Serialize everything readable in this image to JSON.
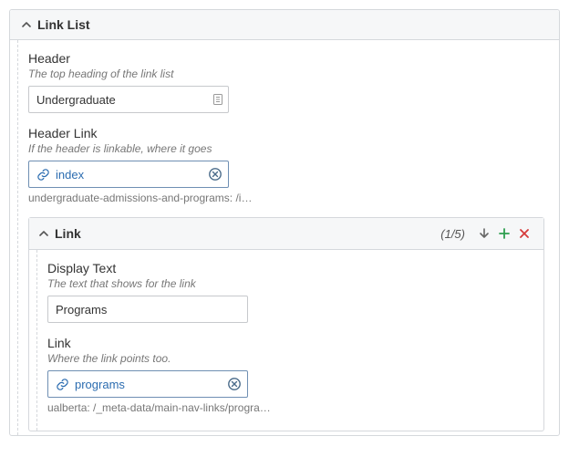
{
  "panel": {
    "title": "Link List",
    "header_field": {
      "label": "Header",
      "desc": "The top heading of the link list",
      "value": "Undergraduate"
    },
    "header_link_field": {
      "label": "Header Link",
      "desc": "If the header is linkable, where it goes",
      "value": "index",
      "path": "undergraduate-admissions-and-programs: /i…"
    },
    "link_sub": {
      "title": "Link",
      "counter": "(1/5)",
      "display_text": {
        "label": "Display Text",
        "desc": "The text that shows for the link",
        "value": "Programs"
      },
      "link_field": {
        "label": "Link",
        "desc": "Where the link points too.",
        "value": "programs",
        "path": "ualberta: /_meta-data/main-nav-links/progra…"
      }
    }
  }
}
